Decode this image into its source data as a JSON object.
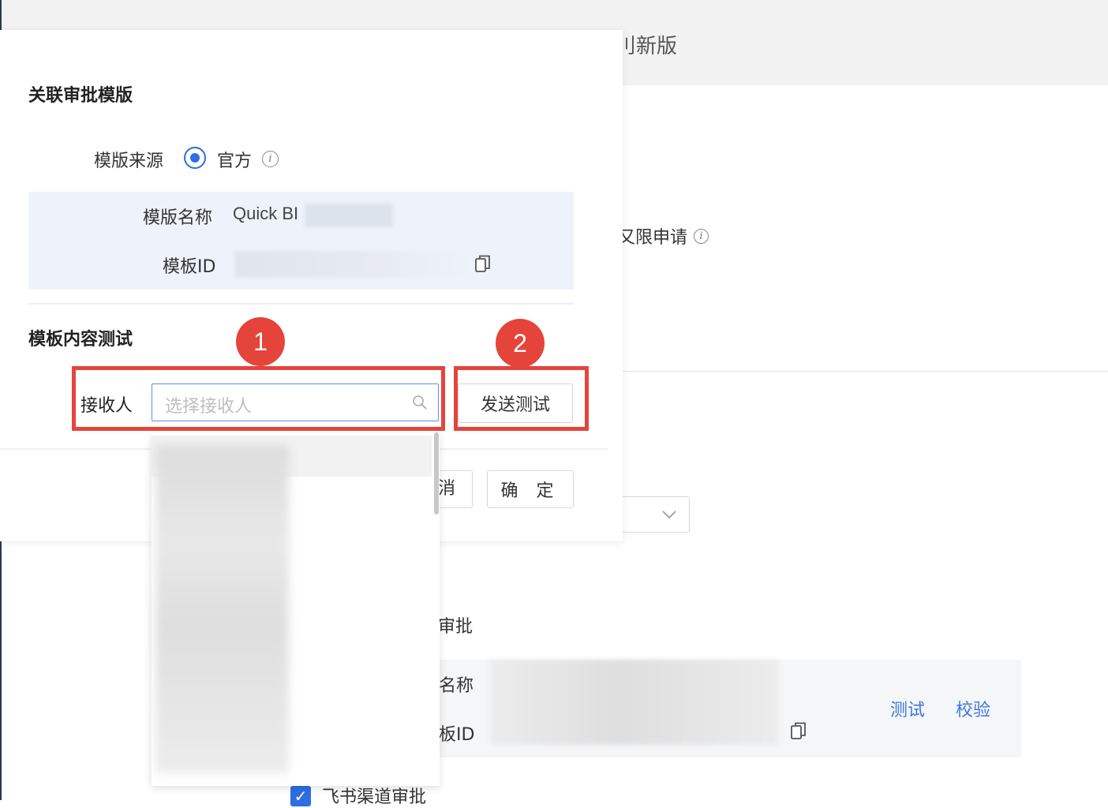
{
  "background": {
    "title_fragment": "刂新版",
    "permission_fragment": "又限申请",
    "approval_fragment": "审批",
    "name_label_fragment": "名称",
    "id_label_fragment": "板ID",
    "test_link": "测试",
    "verify_link": "校验",
    "feishu_checkbox_label": "飞书渠道审批",
    "feishu_checked": true
  },
  "modal": {
    "link_section_title": "关联审批模版",
    "source": {
      "label": "模版来源",
      "value": "官方",
      "selected": true
    },
    "template": {
      "name_label": "模版名称",
      "name_value": "Quick BI",
      "id_label": "模板ID"
    },
    "test_section_title": "模板内容测试",
    "receiver": {
      "label": "接收人",
      "placeholder": "选择接收人"
    },
    "send_test_button": "发送测试",
    "cancel_button": "消",
    "ok_button": "确 定"
  },
  "annotations": {
    "badge_1": "1",
    "badge_2": "2",
    "accent_color": "#e5443b"
  },
  "colors": {
    "primary": "#2f6de1",
    "link": "#3d77e0"
  }
}
